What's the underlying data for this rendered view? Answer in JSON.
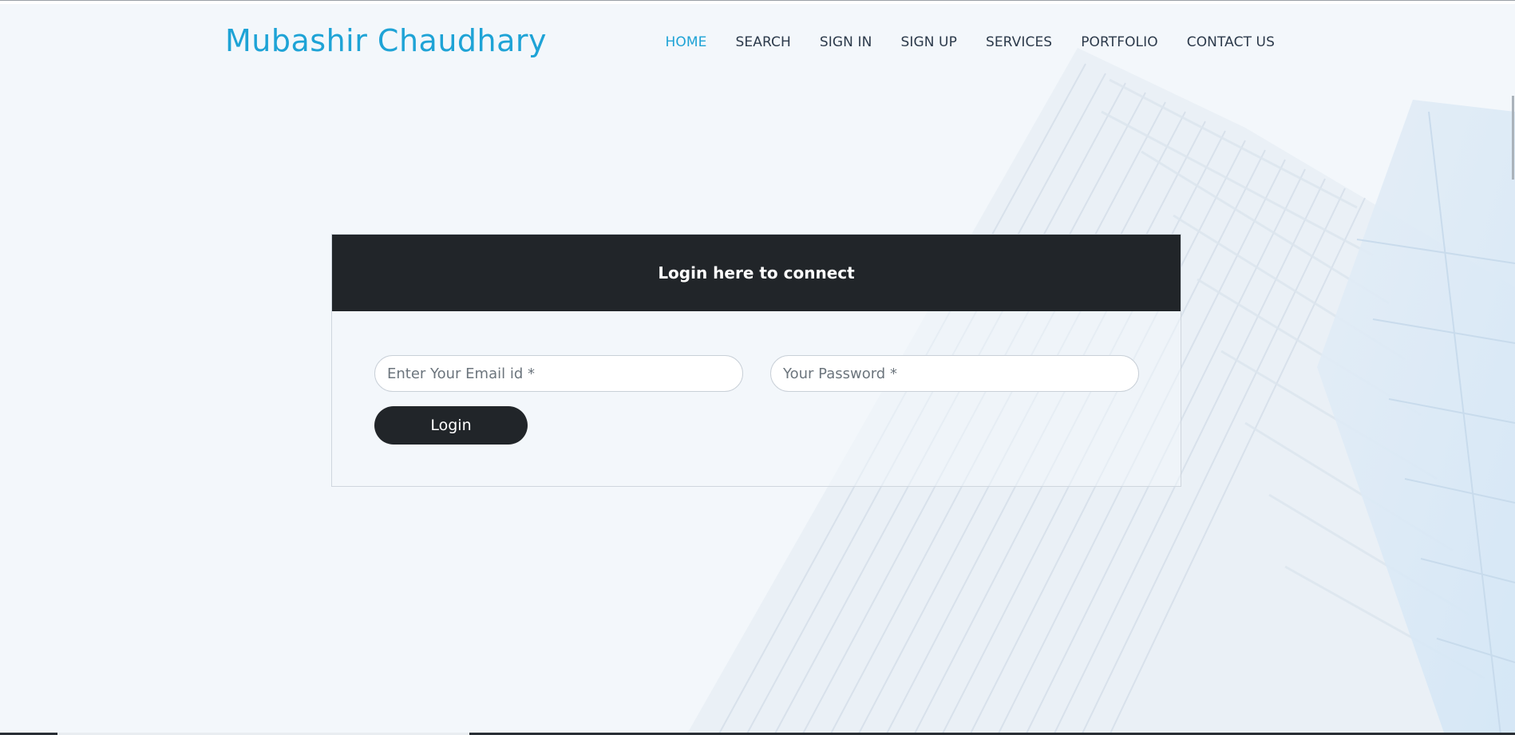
{
  "brand": {
    "name": "Mubashir Chaudhary"
  },
  "nav": {
    "items": [
      {
        "label": "HOME",
        "active": true
      },
      {
        "label": "SEARCH"
      },
      {
        "label": "SIGN IN"
      },
      {
        "label": "SIGN UP"
      },
      {
        "label": "SERVICES"
      },
      {
        "label": "PORTFOLIO"
      },
      {
        "label": "CONTACT US"
      }
    ]
  },
  "login": {
    "title": "Login here to connect",
    "email_placeholder": "Enter Your Email id *",
    "email_value": "",
    "password_placeholder": "Your Password *",
    "password_value": "",
    "button_label": "Login"
  },
  "colors": {
    "accent": "#1ea3d6",
    "dark": "#212529",
    "background": "#f3f7fb"
  }
}
